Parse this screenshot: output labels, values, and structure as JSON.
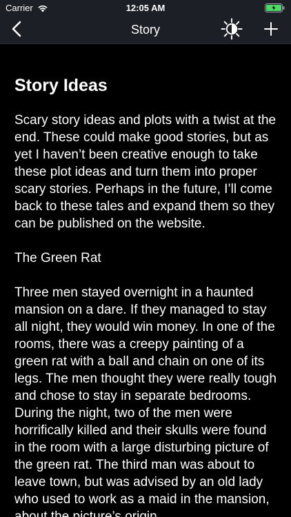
{
  "status_bar": {
    "carrier": "Carrier",
    "time": "12:05 AM",
    "icons": [
      "wifi-icon",
      "battery-icon"
    ]
  },
  "nav": {
    "title": "Story",
    "back_icon": "chevron-left-icon",
    "brightness_icon": "brightness-icon",
    "add_icon": "plus-icon"
  },
  "story": {
    "title": "Story Ideas",
    "intro": "Scary story ideas and plots with a twist at the end. These could make good stories, but as yet I haven’t been creative enough to take these plot ideas and turn them into proper scary stories. Perhaps in the future, I’ll come back to these tales and expand them so they can be published on the website.",
    "section_heading": "The Green Rat",
    "section_body": "Three men stayed overnight in a haunted mansion on a dare. If they managed to stay all night, they would win money. In one of the rooms, there was a creepy painting of a green rat with a ball and chain on one of its legs. The men thought they were really tough and chose to stay in separate bedrooms. During the night, two of the men were horrifically killed and their skulls were found in the room with a large disturbing picture of the green rat. The third man was about to leave town, but was advised by an old lady who used to work as a maid in the mansion, about the picture’s origin,"
  },
  "colors": {
    "bar_background": "#1c1f26",
    "content_background": "#000000",
    "text": "#ffffff",
    "battery_fill": "#4cd964"
  }
}
